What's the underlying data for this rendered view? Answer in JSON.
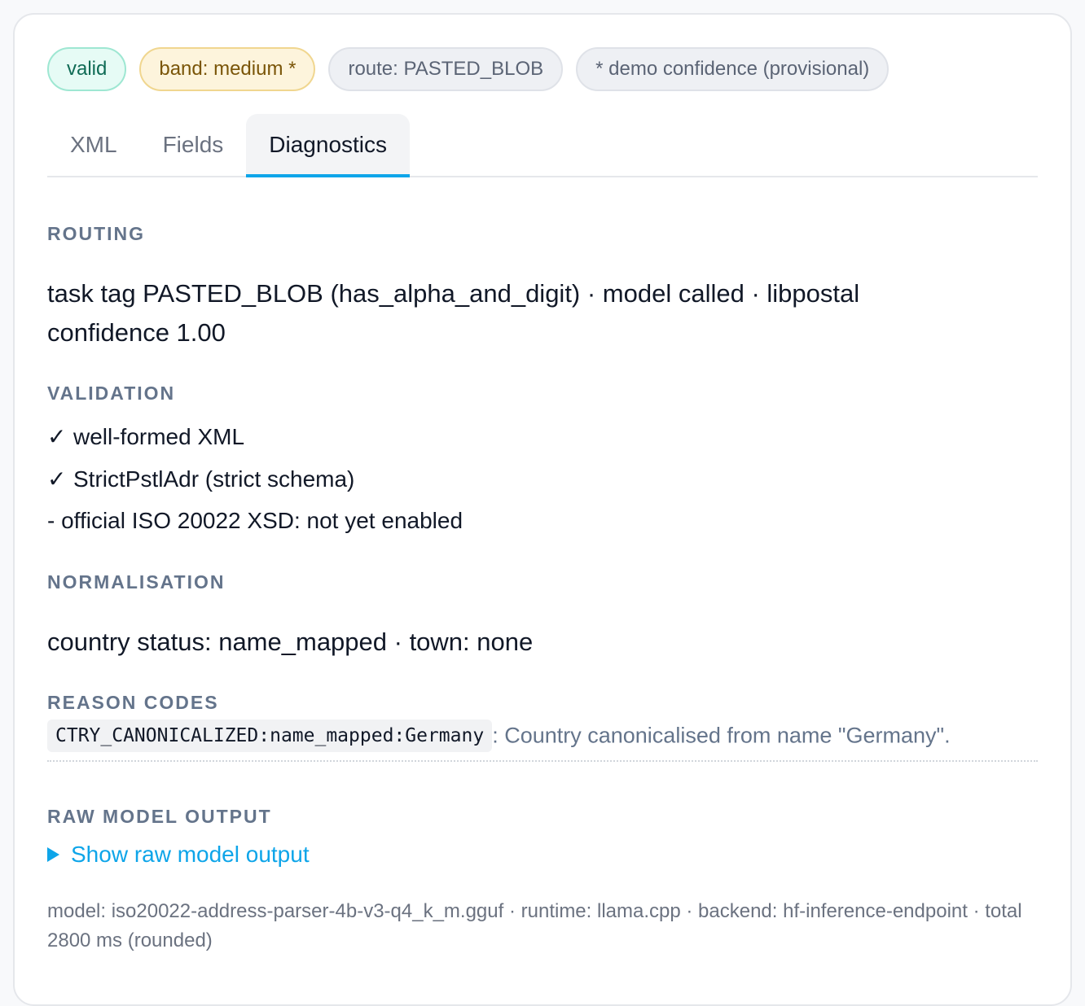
{
  "badges": {
    "valid": "valid",
    "band": "band: medium *",
    "route": "route: PASTED_BLOB",
    "demo": "* demo confidence (provisional)"
  },
  "tabs": [
    "XML",
    "Fields",
    "Diagnostics"
  ],
  "active_tab": "Diagnostics",
  "routing": {
    "label": "ROUTING",
    "text": "task tag PASTED_BLOB (has_alpha_and_digit) · model called · libpostal confidence 1.00"
  },
  "validation": {
    "label": "VALIDATION",
    "items": [
      {
        "mark": "✓",
        "text": "well-formed XML"
      },
      {
        "mark": "✓",
        "text": "StrictPstlAdr (strict schema)"
      },
      {
        "mark": "-",
        "text": "official ISO 20022 XSD: not yet enabled"
      }
    ]
  },
  "normalisation": {
    "label": "NORMALISATION",
    "text": "country status: name_mapped · town: none"
  },
  "reason_codes": {
    "label": "REASON CODES",
    "items": [
      {
        "code": "CTRY_CANONICALIZED:name_mapped:Germany",
        "description": ": Country canonicalised from name \"Germany\"."
      }
    ]
  },
  "raw_output": {
    "label": "RAW MODEL OUTPUT",
    "toggle": "Show raw model output"
  },
  "meta": "model: iso20022-address-parser-4b-v3-q4_k_m.gguf · runtime: llama.cpp · backend: hf-inference-endpoint · total 2800 ms (rounded)",
  "colors": {
    "accent": "#0ea5e9",
    "valid_bg": "#e6fbf5",
    "band_bg": "#fdf4dc",
    "muted": "#64748b"
  }
}
